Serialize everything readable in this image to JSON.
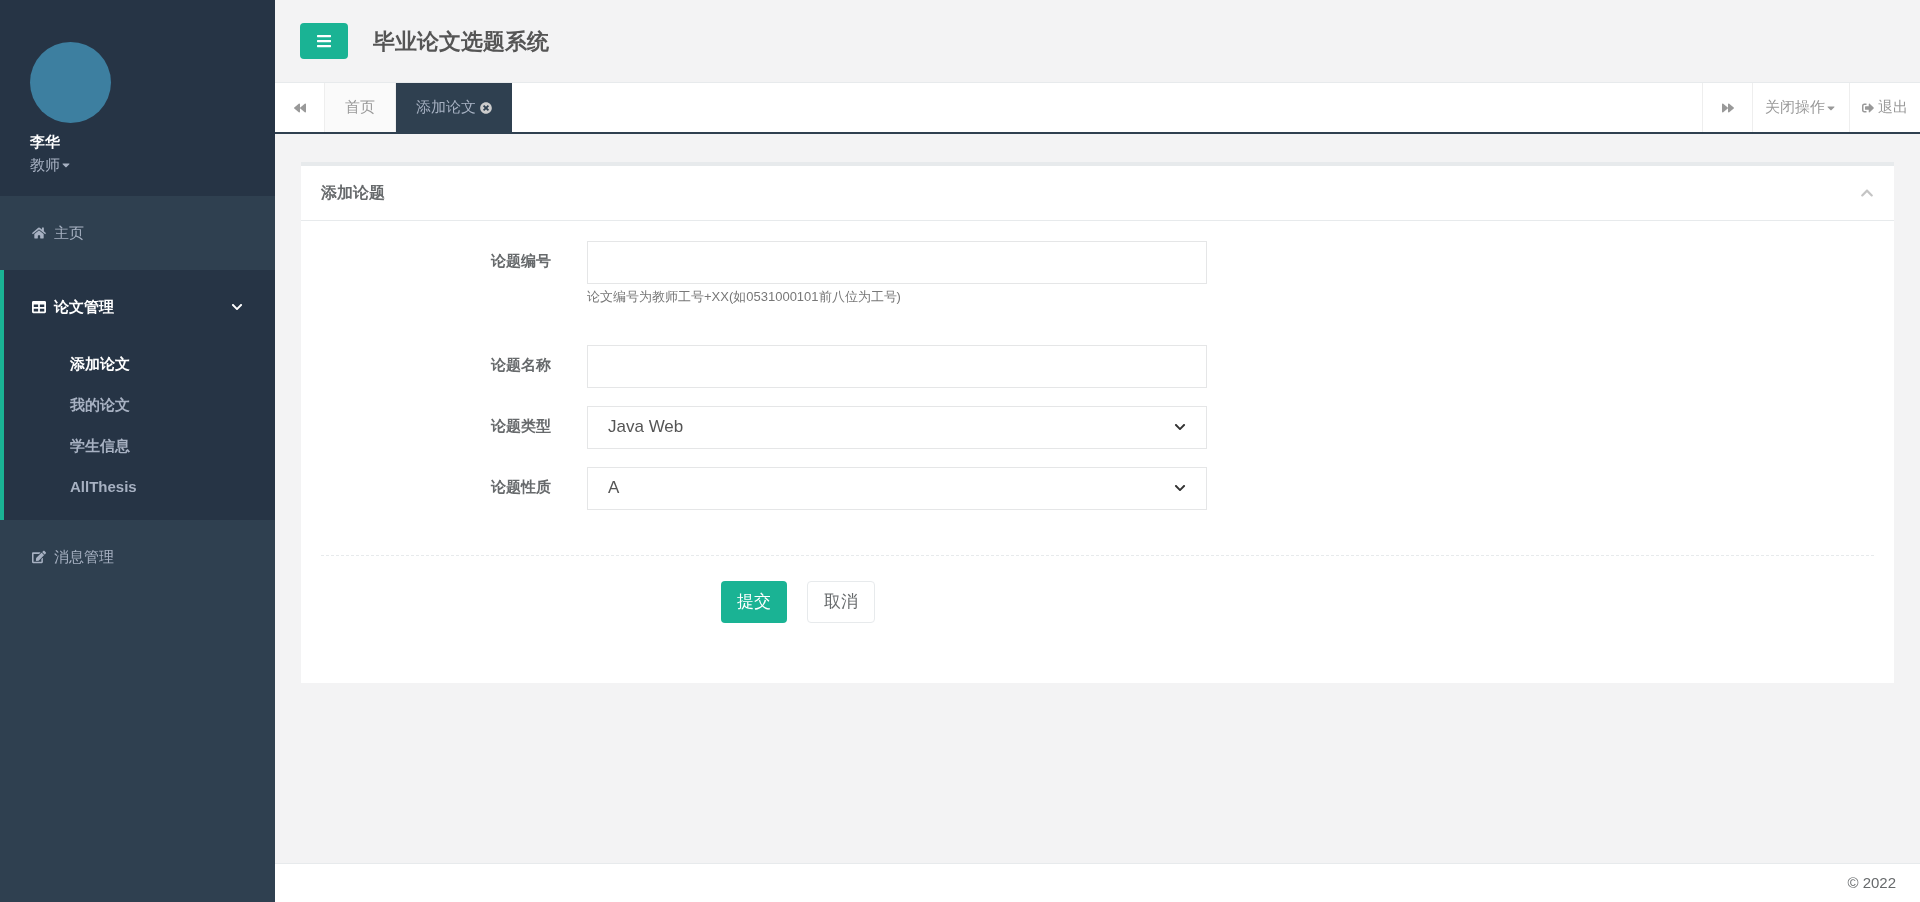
{
  "user": {
    "name": "李华",
    "role": "教师"
  },
  "sidebar": {
    "items": [
      {
        "label": "主页",
        "kind": "home",
        "expanded": false,
        "selected": false
      },
      {
        "label": "论文管理",
        "kind": "table",
        "expanded": true,
        "selected": true,
        "children": [
          {
            "label": "添加论文",
            "selected": true
          },
          {
            "label": "我的论文",
            "selected": false
          },
          {
            "label": "学生信息",
            "selected": false
          },
          {
            "label": "AllThesis",
            "selected": false
          }
        ]
      },
      {
        "label": "消息管理",
        "kind": "edit",
        "expanded": false,
        "selected": false
      }
    ]
  },
  "header": {
    "title": "毕业论文选题系统"
  },
  "tabs": [
    {
      "label": "首页",
      "selected": false,
      "closable": false
    },
    {
      "label": "添加论文",
      "selected": true,
      "closable": true
    }
  ],
  "tab_actions": {
    "close_ops": "关闭操作",
    "logout": "退出"
  },
  "panel": {
    "title": "添加论题",
    "fields": [
      {
        "kind": "text",
        "label": "论题编号",
        "help": "论文编号为教师工号+XX(如0531000101前八位为工号)"
      },
      {
        "kind": "text",
        "label": "论题名称"
      },
      {
        "kind": "select",
        "label": "论题类型",
        "value": "Java Web"
      },
      {
        "kind": "select",
        "label": "论题性质",
        "value": "A"
      }
    ],
    "buttons": [
      {
        "kind": "primary",
        "label": "提交"
      },
      {
        "kind": "default",
        "label": "取消"
      }
    ]
  },
  "footer": {
    "text": "© 2022"
  }
}
